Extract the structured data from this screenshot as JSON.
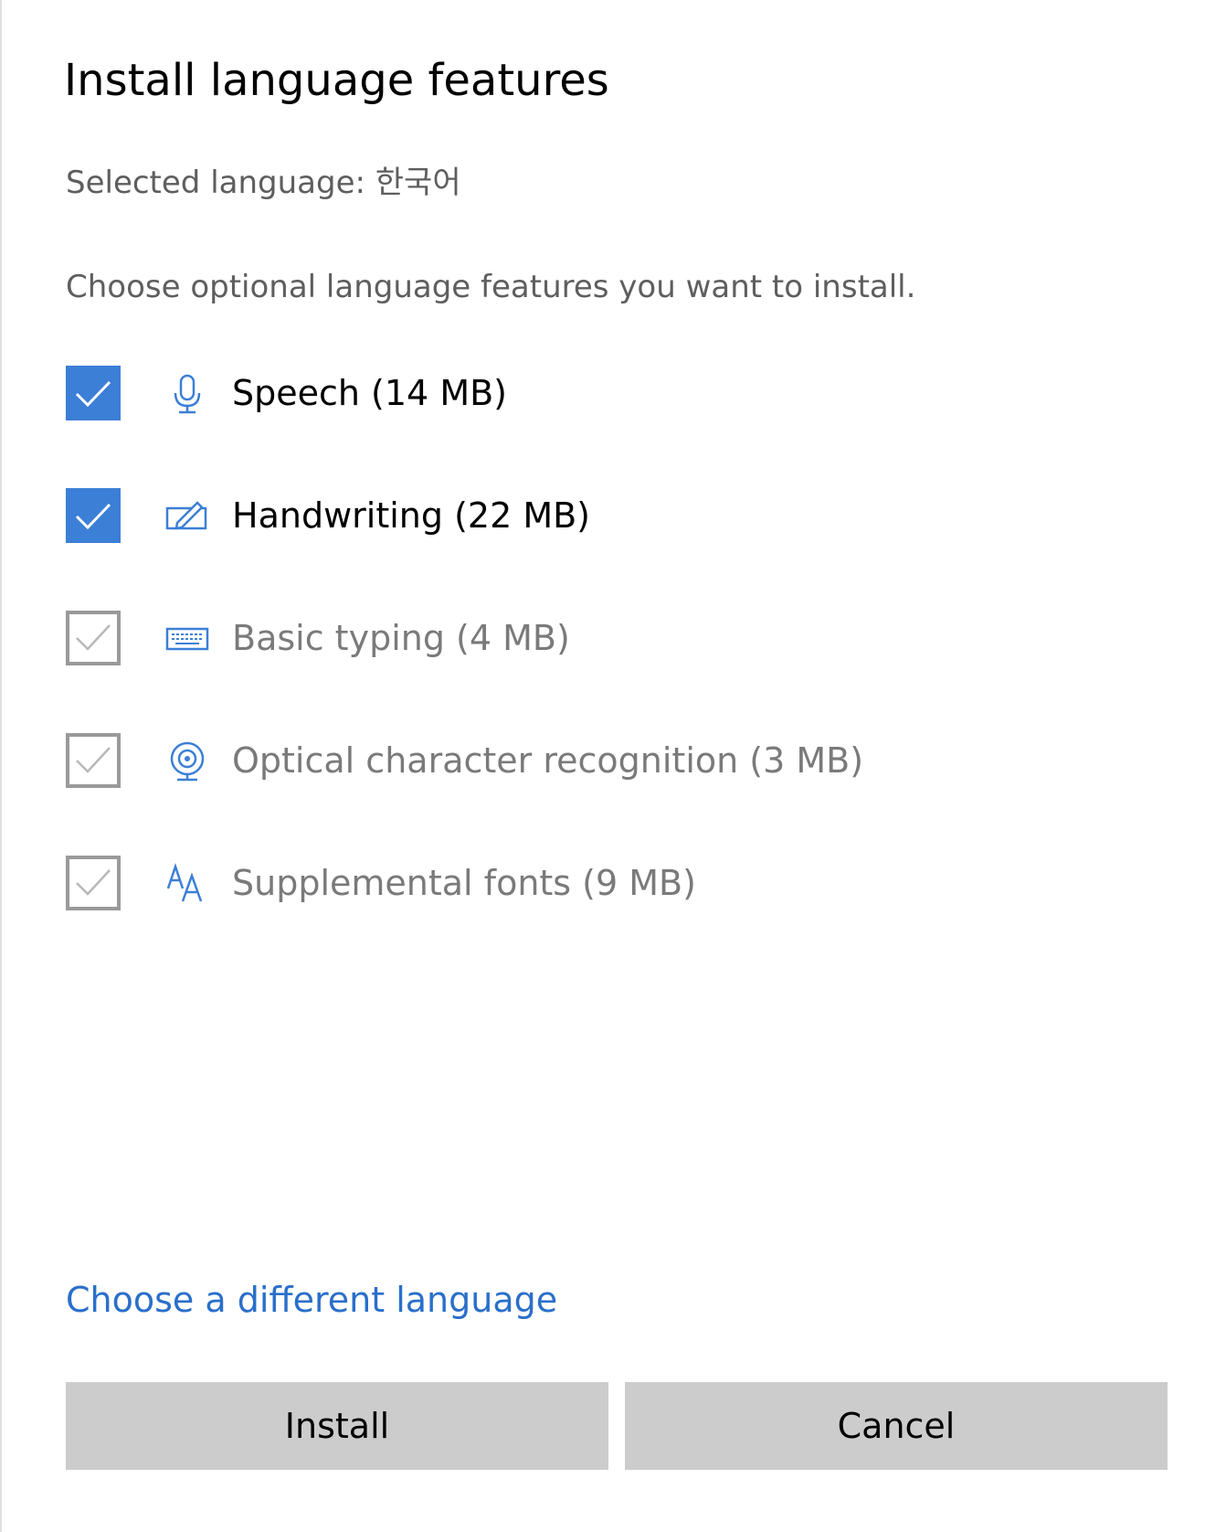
{
  "dialog": {
    "title": "Install language features",
    "selected_language": "Selected language: 한국어",
    "instructions": "Choose optional language features you want to install."
  },
  "features": [
    {
      "label": "Speech (14 MB)",
      "icon": "microphone-icon",
      "checked": true,
      "enabled": true
    },
    {
      "label": "Handwriting (22 MB)",
      "icon": "pen-icon",
      "checked": true,
      "enabled": true
    },
    {
      "label": "Basic typing (4 MB)",
      "icon": "keyboard-icon",
      "checked": true,
      "enabled": false
    },
    {
      "label": "Optical character recognition (3 MB)",
      "icon": "camera-icon",
      "checked": true,
      "enabled": false
    },
    {
      "label": "Supplemental fonts (9 MB)",
      "icon": "font-icon",
      "checked": true,
      "enabled": false
    }
  ],
  "links": {
    "different_language": "Choose a different language"
  },
  "buttons": {
    "install": "Install",
    "cancel": "Cancel"
  },
  "colors": {
    "accent": "#3c7fd6",
    "link": "#2a6fca",
    "button_bg": "#cccccc",
    "disabled_border": "#9a9a9a"
  }
}
